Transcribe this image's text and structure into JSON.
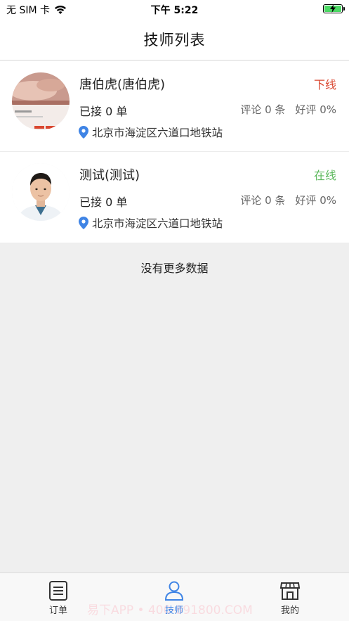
{
  "status_bar": {
    "carrier": "无 SIM 卡",
    "time": "下午 5:22"
  },
  "nav": {
    "title": "技师列表"
  },
  "technicians": [
    {
      "name": "唐伯虎(唐伯虎)",
      "status": "下线",
      "status_color": "#d9462f",
      "orders": "已接 0 单",
      "comments": "评论 0 条",
      "rating": "好评 0%",
      "address": "北京市海淀区六道口地铁站",
      "avatar_icon": "massage-photo"
    },
    {
      "name": "测试(测试)",
      "status": "在线",
      "status_color": "#5cb85c",
      "orders": "已接 0 单",
      "comments": "评论 0 条",
      "rating": "好评 0%",
      "address": "北京市海淀区六道口地铁站",
      "avatar_icon": "person-portrait"
    }
  ],
  "list_footer": "没有更多数据",
  "tab_bar": {
    "tabs": [
      {
        "label": "订单",
        "icon": "order-list-icon",
        "active": false
      },
      {
        "label": "技师",
        "icon": "person-icon",
        "active": true
      },
      {
        "label": "我的",
        "icon": "store-icon",
        "active": false
      }
    ],
    "watermark": "易下APP • 400-891800.COM"
  },
  "colors": {
    "accent": "#3f84e5",
    "offline": "#d9462f",
    "online": "#5cb85c",
    "pin": "#3f84e5"
  }
}
